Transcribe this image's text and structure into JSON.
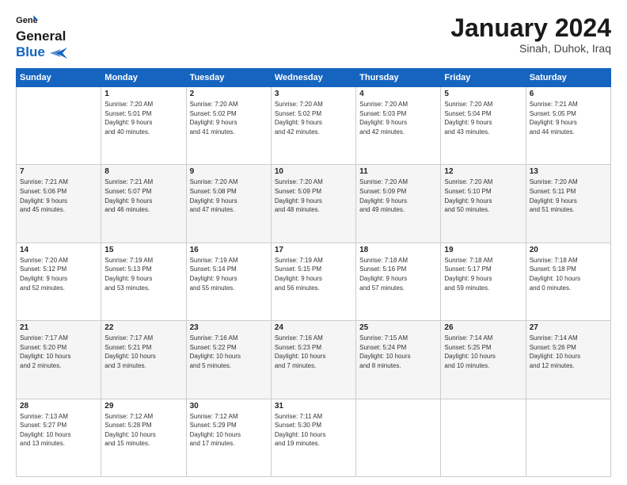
{
  "logo": {
    "general": "General",
    "blue": "Blue"
  },
  "header": {
    "month": "January 2024",
    "location": "Sinah, Duhok, Iraq"
  },
  "weekdays": [
    "Sunday",
    "Monday",
    "Tuesday",
    "Wednesday",
    "Thursday",
    "Friday",
    "Saturday"
  ],
  "weeks": [
    [
      {
        "day": "",
        "info": ""
      },
      {
        "day": "1",
        "info": "Sunrise: 7:20 AM\nSunset: 5:01 PM\nDaylight: 9 hours\nand 40 minutes."
      },
      {
        "day": "2",
        "info": "Sunrise: 7:20 AM\nSunset: 5:02 PM\nDaylight: 9 hours\nand 41 minutes."
      },
      {
        "day": "3",
        "info": "Sunrise: 7:20 AM\nSunset: 5:02 PM\nDaylight: 9 hours\nand 42 minutes."
      },
      {
        "day": "4",
        "info": "Sunrise: 7:20 AM\nSunset: 5:03 PM\nDaylight: 9 hours\nand 42 minutes."
      },
      {
        "day": "5",
        "info": "Sunrise: 7:20 AM\nSunset: 5:04 PM\nDaylight: 9 hours\nand 43 minutes."
      },
      {
        "day": "6",
        "info": "Sunrise: 7:21 AM\nSunset: 5:05 PM\nDaylight: 9 hours\nand 44 minutes."
      }
    ],
    [
      {
        "day": "7",
        "info": "Sunrise: 7:21 AM\nSunset: 5:06 PM\nDaylight: 9 hours\nand 45 minutes."
      },
      {
        "day": "8",
        "info": "Sunrise: 7:21 AM\nSunset: 5:07 PM\nDaylight: 9 hours\nand 46 minutes."
      },
      {
        "day": "9",
        "info": "Sunrise: 7:20 AM\nSunset: 5:08 PM\nDaylight: 9 hours\nand 47 minutes."
      },
      {
        "day": "10",
        "info": "Sunrise: 7:20 AM\nSunset: 5:09 PM\nDaylight: 9 hours\nand 48 minutes."
      },
      {
        "day": "11",
        "info": "Sunrise: 7:20 AM\nSunset: 5:09 PM\nDaylight: 9 hours\nand 49 minutes."
      },
      {
        "day": "12",
        "info": "Sunrise: 7:20 AM\nSunset: 5:10 PM\nDaylight: 9 hours\nand 50 minutes."
      },
      {
        "day": "13",
        "info": "Sunrise: 7:20 AM\nSunset: 5:11 PM\nDaylight: 9 hours\nand 51 minutes."
      }
    ],
    [
      {
        "day": "14",
        "info": "Sunrise: 7:20 AM\nSunset: 5:12 PM\nDaylight: 9 hours\nand 52 minutes."
      },
      {
        "day": "15",
        "info": "Sunrise: 7:19 AM\nSunset: 5:13 PM\nDaylight: 9 hours\nand 53 minutes."
      },
      {
        "day": "16",
        "info": "Sunrise: 7:19 AM\nSunset: 5:14 PM\nDaylight: 9 hours\nand 55 minutes."
      },
      {
        "day": "17",
        "info": "Sunrise: 7:19 AM\nSunset: 5:15 PM\nDaylight: 9 hours\nand 56 minutes."
      },
      {
        "day": "18",
        "info": "Sunrise: 7:18 AM\nSunset: 5:16 PM\nDaylight: 9 hours\nand 57 minutes."
      },
      {
        "day": "19",
        "info": "Sunrise: 7:18 AM\nSunset: 5:17 PM\nDaylight: 9 hours\nand 59 minutes."
      },
      {
        "day": "20",
        "info": "Sunrise: 7:18 AM\nSunset: 5:18 PM\nDaylight: 10 hours\nand 0 minutes."
      }
    ],
    [
      {
        "day": "21",
        "info": "Sunrise: 7:17 AM\nSunset: 5:20 PM\nDaylight: 10 hours\nand 2 minutes."
      },
      {
        "day": "22",
        "info": "Sunrise: 7:17 AM\nSunset: 5:21 PM\nDaylight: 10 hours\nand 3 minutes."
      },
      {
        "day": "23",
        "info": "Sunrise: 7:16 AM\nSunset: 5:22 PM\nDaylight: 10 hours\nand 5 minutes."
      },
      {
        "day": "24",
        "info": "Sunrise: 7:16 AM\nSunset: 5:23 PM\nDaylight: 10 hours\nand 7 minutes."
      },
      {
        "day": "25",
        "info": "Sunrise: 7:15 AM\nSunset: 5:24 PM\nDaylight: 10 hours\nand 8 minutes."
      },
      {
        "day": "26",
        "info": "Sunrise: 7:14 AM\nSunset: 5:25 PM\nDaylight: 10 hours\nand 10 minutes."
      },
      {
        "day": "27",
        "info": "Sunrise: 7:14 AM\nSunset: 5:26 PM\nDaylight: 10 hours\nand 12 minutes."
      }
    ],
    [
      {
        "day": "28",
        "info": "Sunrise: 7:13 AM\nSunset: 5:27 PM\nDaylight: 10 hours\nand 13 minutes."
      },
      {
        "day": "29",
        "info": "Sunrise: 7:12 AM\nSunset: 5:28 PM\nDaylight: 10 hours\nand 15 minutes."
      },
      {
        "day": "30",
        "info": "Sunrise: 7:12 AM\nSunset: 5:29 PM\nDaylight: 10 hours\nand 17 minutes."
      },
      {
        "day": "31",
        "info": "Sunrise: 7:11 AM\nSunset: 5:30 PM\nDaylight: 10 hours\nand 19 minutes."
      },
      {
        "day": "",
        "info": ""
      },
      {
        "day": "",
        "info": ""
      },
      {
        "day": "",
        "info": ""
      }
    ]
  ]
}
